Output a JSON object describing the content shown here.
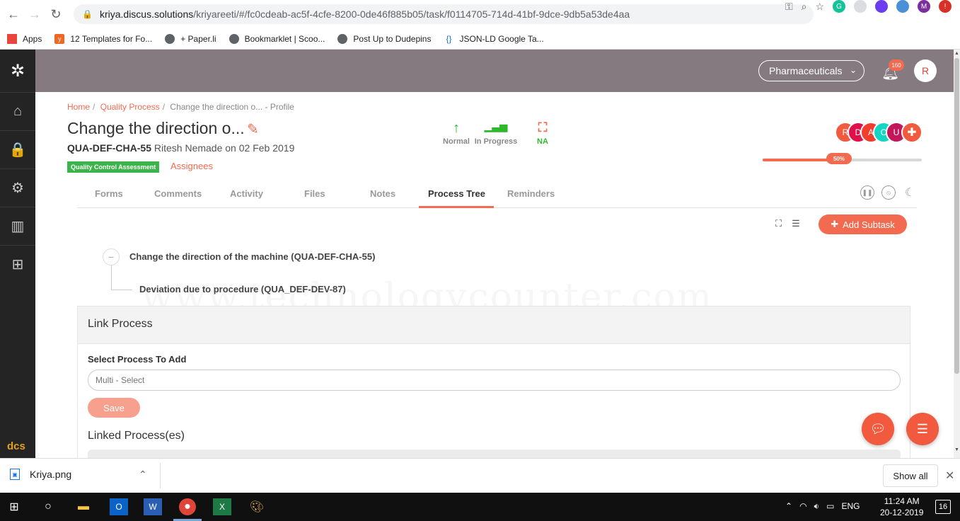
{
  "browser": {
    "url_host": "kriya.discus.solutions",
    "url_path": "/kriyareeti/#/fc0cdeab-ac5f-4cfe-8200-0de46f885b05/task/f0114705-714d-41bf-9dce-9db5a53de4aa",
    "ext_avatar_letter": "M",
    "bookmarks": [
      {
        "label": "Apps",
        "icon": "apps-grid-icon",
        "color": "#e8453c"
      },
      {
        "label": "12 Templates for Fo...",
        "icon": "bookmark-y-icon",
        "color": "#f26522"
      },
      {
        "label": "+ Paper.li",
        "icon": "globe-icon",
        "color": "#5f6368"
      },
      {
        "label": "Bookmarklet | Scoo...",
        "icon": "globe-icon",
        "color": "#5f6368"
      },
      {
        "label": "Post Up to Dudepins",
        "icon": "globe-icon",
        "color": "#5f6368"
      },
      {
        "label": "JSON-LD Google Ta...",
        "icon": "braces-icon",
        "color": "#1a73e8"
      }
    ]
  },
  "header": {
    "department": "Pharmaceuticals",
    "notification_count": "160",
    "user_initial": "R"
  },
  "breadcrumb": {
    "home": "Home",
    "section": "Quality Process",
    "current": "Change the direction o... - Profile"
  },
  "task": {
    "title": "Change the direction o...",
    "code": "QUA-DEF-CHA-55",
    "meta": "Ritesh Nemade on 02 Feb 2019",
    "tag": "Quality Control Assessment",
    "assignees_label": "Assignees",
    "priority": "Normal",
    "status": "In Progress",
    "hierarchy": "NA",
    "progress_label": "50%",
    "progress_value": 0.5
  },
  "assignees": [
    {
      "initial": "R",
      "color": "#f15a3e"
    },
    {
      "initial": "D",
      "color": "#e0104a"
    },
    {
      "initial": "A",
      "color": "#f23d2e"
    },
    {
      "initial": "C",
      "color": "#14d4c4"
    },
    {
      "initial": "U",
      "color": "#c2185b"
    }
  ],
  "tabs": [
    "Forms",
    "Comments",
    "Activity",
    "Files",
    "Notes",
    "Process Tree",
    "Reminders"
  ],
  "active_tab": "Process Tree",
  "actions": {
    "add_subtask": "Add Subtask"
  },
  "process_tree": {
    "root": "Change the direction of the machine (QUA-DEF-CHA-55)",
    "child": "Deviation due to procedure (QUA_DEF-DEV-87)"
  },
  "watermark": "www.technologycounter.com",
  "link_process": {
    "title": "Link Process",
    "select_label": "Select Process To Add",
    "placeholder": "Multi - Select",
    "save_label": "Save",
    "linked_title": "Linked Process(es)"
  },
  "download": {
    "file_name": "Kriya.png",
    "show_all": "Show all"
  },
  "taskbar": {
    "language": "ENG",
    "time": "11:24 AM",
    "date": "20-12-2019",
    "notifications": "16"
  },
  "colors": {
    "accent": "#f26a4f",
    "topbar": "#857a80",
    "sidebar": "#242424",
    "tag_green": "#3cb44b",
    "priority_green": "#2eb82e"
  }
}
